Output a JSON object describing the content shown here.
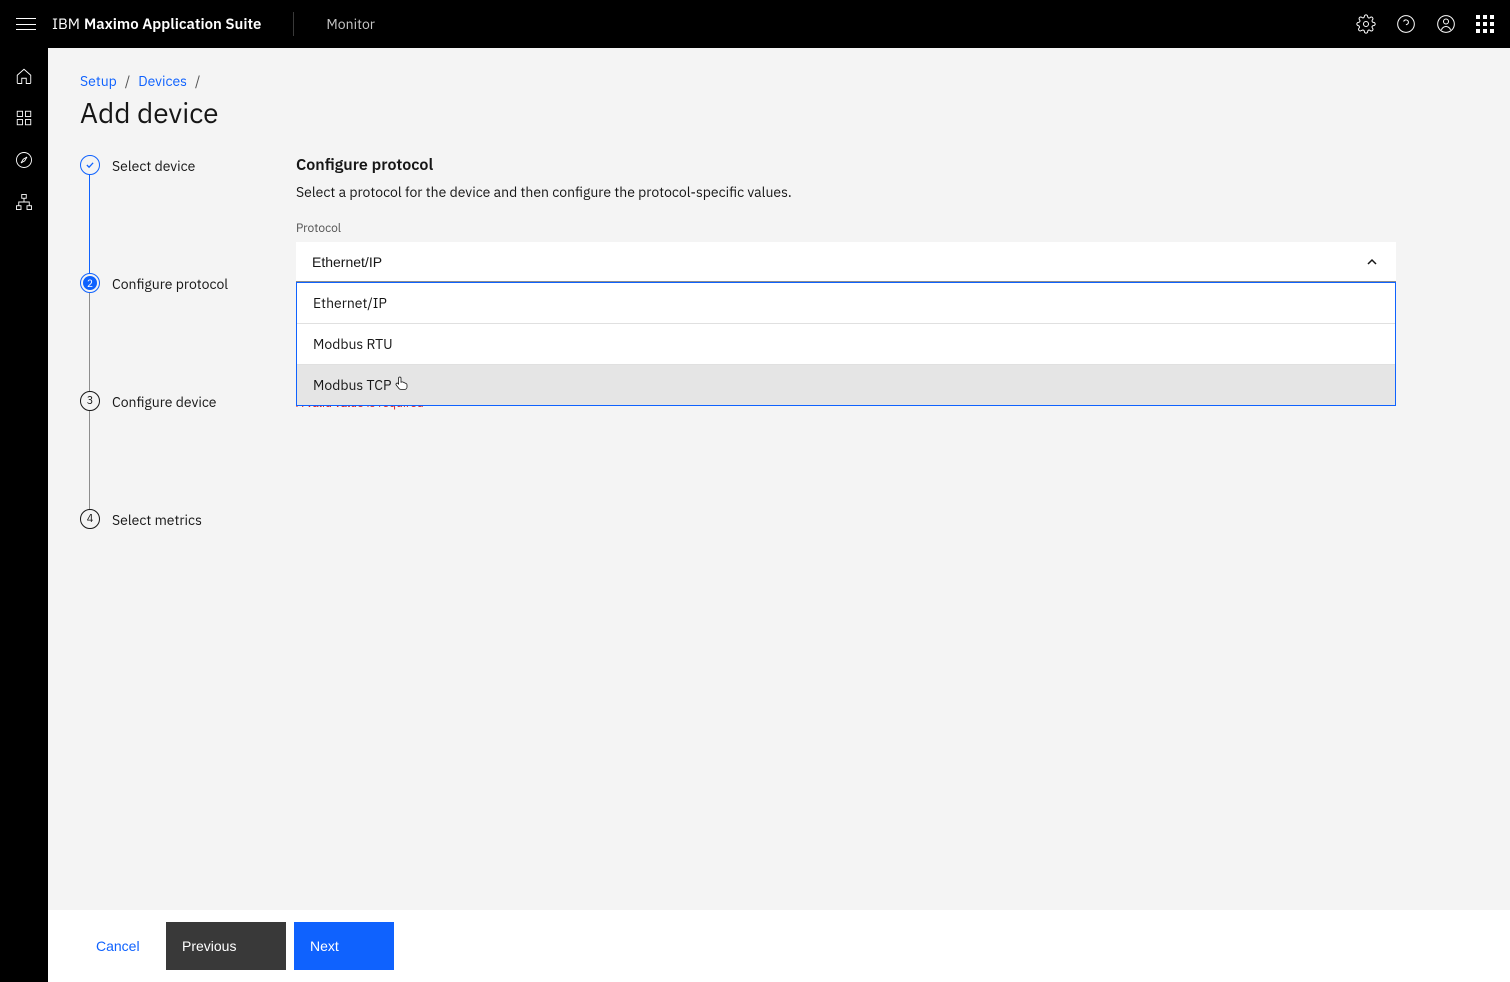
{
  "header": {
    "brand_prefix": "IBM",
    "brand_name": "Maximo Application Suite",
    "app_label": "Monitor"
  },
  "breadcrumb": {
    "item0": "Setup",
    "item1": "Devices"
  },
  "page": {
    "title": "Add device"
  },
  "steps": {
    "s1": "Select device",
    "s2": "Configure protocol",
    "s3": "Configure device",
    "s4": "Select metrics",
    "num3": "3",
    "num4": "4"
  },
  "section": {
    "title": "Configure protocol",
    "desc": "Select a protocol for the device and then configure the protocol-specific values.",
    "field_label": "Protocol",
    "validation": "A valid value is required"
  },
  "dropdown": {
    "selected": "Ethernet/IP",
    "options": {
      "o0": "Ethernet/IP",
      "o1": "Modbus RTU",
      "o2": "Modbus TCP"
    }
  },
  "footer": {
    "cancel": "Cancel",
    "prev": "Previous",
    "next": "Next"
  }
}
